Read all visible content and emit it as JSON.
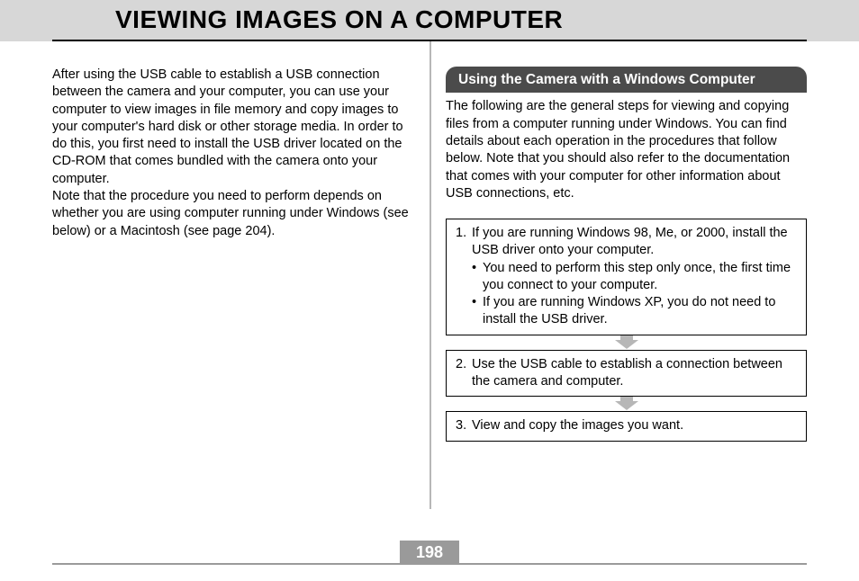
{
  "title": "VIEWING IMAGES ON A COMPUTER",
  "left": {
    "p1": "After using the USB cable to establish a USB connection between the camera and your computer, you can use your computer to view images in file memory and copy images to your computer's hard disk or other storage media. In order to do this, you first need to install the USB driver located on the CD-ROM that comes bundled with the camera onto your computer.",
    "p2": "Note that the procedure you need to perform depends on whether you are using computer running under Windows (see below) or a Macintosh (see page 204)."
  },
  "right": {
    "section_title": "Using the Camera with a Windows Computer",
    "intro": "The following are the general steps for viewing and copying files from a computer running under Windows. You can find details about each operation in the procedures that follow below. Note that you should also refer to the documentation that comes with your computer for other information about USB connections, etc.",
    "steps": [
      {
        "num": "1.",
        "text": "If you are running Windows 98, Me, or 2000, install the USB driver onto your computer.",
        "bullets": [
          "You need to perform this step only once, the first time you connect to your computer.",
          "If you are running Windows XP, you do not need to install the USB driver."
        ]
      },
      {
        "num": "2.",
        "text": "Use the USB cable to establish a connection between the camera and computer.",
        "bullets": []
      },
      {
        "num": "3.",
        "text": "View and copy the images you want.",
        "bullets": []
      }
    ]
  },
  "page_number": "198"
}
